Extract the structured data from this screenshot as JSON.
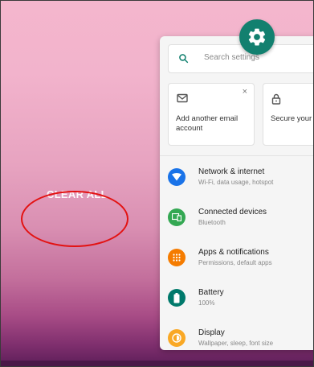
{
  "recents": {
    "clear_all": "CLEAR ALL"
  },
  "settings": {
    "search_placeholder": "Search settings",
    "suggestions": [
      {
        "label": "Add another email account",
        "icon": "mail-icon",
        "close": "×"
      },
      {
        "label": "Secure your",
        "icon": "lock-icon"
      }
    ],
    "items": [
      {
        "title": "Network & internet",
        "subtitle": "Wi-Fi, data usage, hotspot",
        "icon": "wifi-icon",
        "color": "#1a73e8"
      },
      {
        "title": "Connected devices",
        "subtitle": "Bluetooth",
        "icon": "devices-icon",
        "color": "#34a853"
      },
      {
        "title": "Apps & notifications",
        "subtitle": "Permissions, default apps",
        "icon": "apps-icon",
        "color": "#f57c00"
      },
      {
        "title": "Battery",
        "subtitle": "100%",
        "icon": "battery-icon",
        "color": "#00796b"
      },
      {
        "title": "Display",
        "subtitle": "Wallpaper, sleep, font size",
        "icon": "brightness-icon",
        "color": "#f9a825"
      }
    ]
  },
  "colors": {
    "accent": "#12806f",
    "annotation": "#e31212"
  }
}
